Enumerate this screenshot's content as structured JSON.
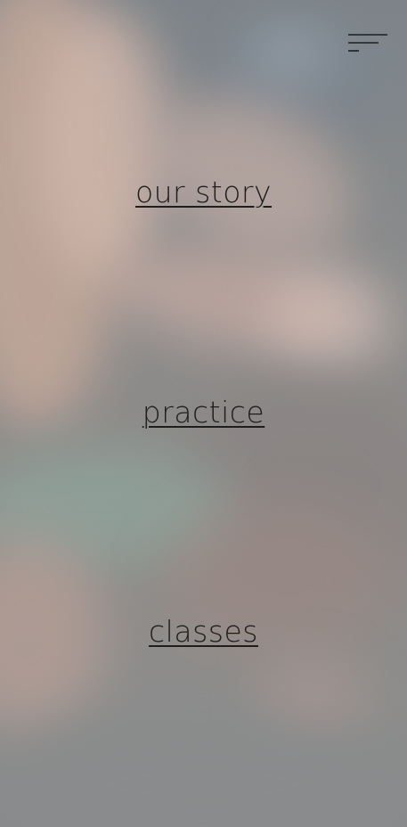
{
  "header": {
    "menu_icon": "hamburger-menu-icon"
  },
  "nav": {
    "items": [
      {
        "label": "our story"
      },
      {
        "label": "practice"
      },
      {
        "label": "classes"
      }
    ]
  },
  "colors": {
    "link_text": "#1e1e1e",
    "icon_stroke": "#1e1e1e"
  }
}
